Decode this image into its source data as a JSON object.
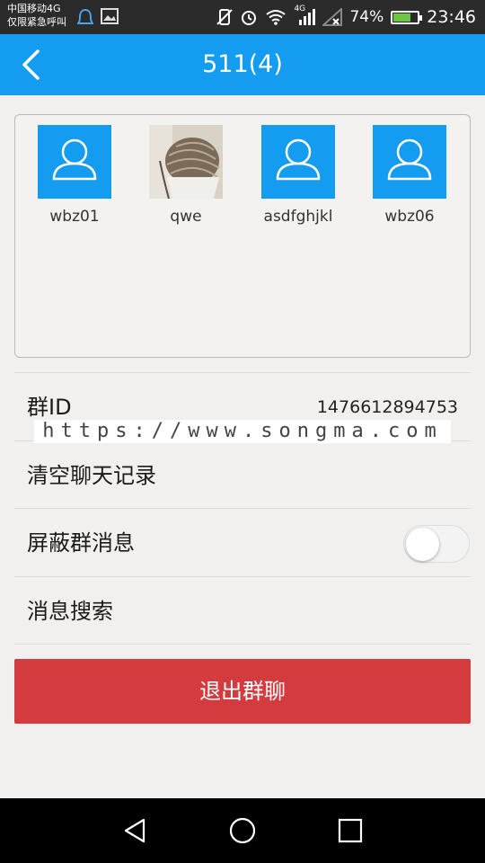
{
  "status_bar": {
    "carrier_line1": "中国移动4G",
    "carrier_line2": "仅限紧急呼叫",
    "network_label": "4G",
    "battery_percent": "74%",
    "battery_level": 0.74,
    "time": "23:46"
  },
  "header": {
    "title": "511(4)"
  },
  "members": [
    {
      "name": "wbz01",
      "avatar": "default-user-icon"
    },
    {
      "name": "qwe",
      "avatar": "yarn-photo"
    },
    {
      "name": "asdfghjkl",
      "avatar": "default-user-icon"
    },
    {
      "name": "wbz06",
      "avatar": "default-user-icon"
    }
  ],
  "settings": {
    "group_id_label": "群ID",
    "group_id_value": "1476612894753",
    "clear_history_label": "清空聊天记录",
    "mute_label": "屏蔽群消息",
    "mute_enabled": false,
    "search_label": "消息搜索"
  },
  "watermark": "https://www.songma.com",
  "exit_button_label": "退出群聊",
  "colors": {
    "accent": "#139cf0",
    "danger": "#d43b3f"
  }
}
